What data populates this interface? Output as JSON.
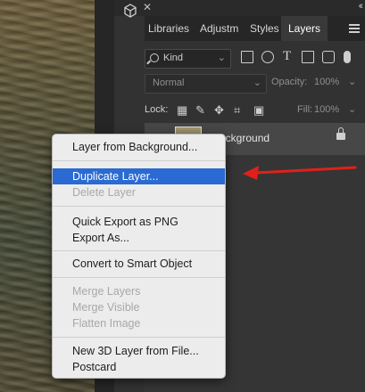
{
  "tabs": [
    "Libraries",
    "Adjustm",
    "Styles",
    "Layers"
  ],
  "filter": {
    "kind_label": "Kind"
  },
  "blend": {
    "mode": "Normal",
    "opacity_label": "Opacity:",
    "opacity_value": "100%"
  },
  "lock_row": {
    "lock_label": "Lock:",
    "fill_label": "Fill:",
    "fill_value": "100%"
  },
  "layer": {
    "name": "Background"
  },
  "context_menu": {
    "items": [
      "Layer from Background...",
      "Duplicate Layer...",
      "Delete Layer",
      "Quick Export as PNG",
      "Export As...",
      "Convert to Smart Object",
      "Merge Layers",
      "Merge Visible",
      "Flatten Image",
      "New 3D Layer from File...",
      "Postcard"
    ]
  },
  "colors": {
    "highlight": "#2a6ad2",
    "arrow": "#e0201b",
    "panel": "#323232"
  }
}
